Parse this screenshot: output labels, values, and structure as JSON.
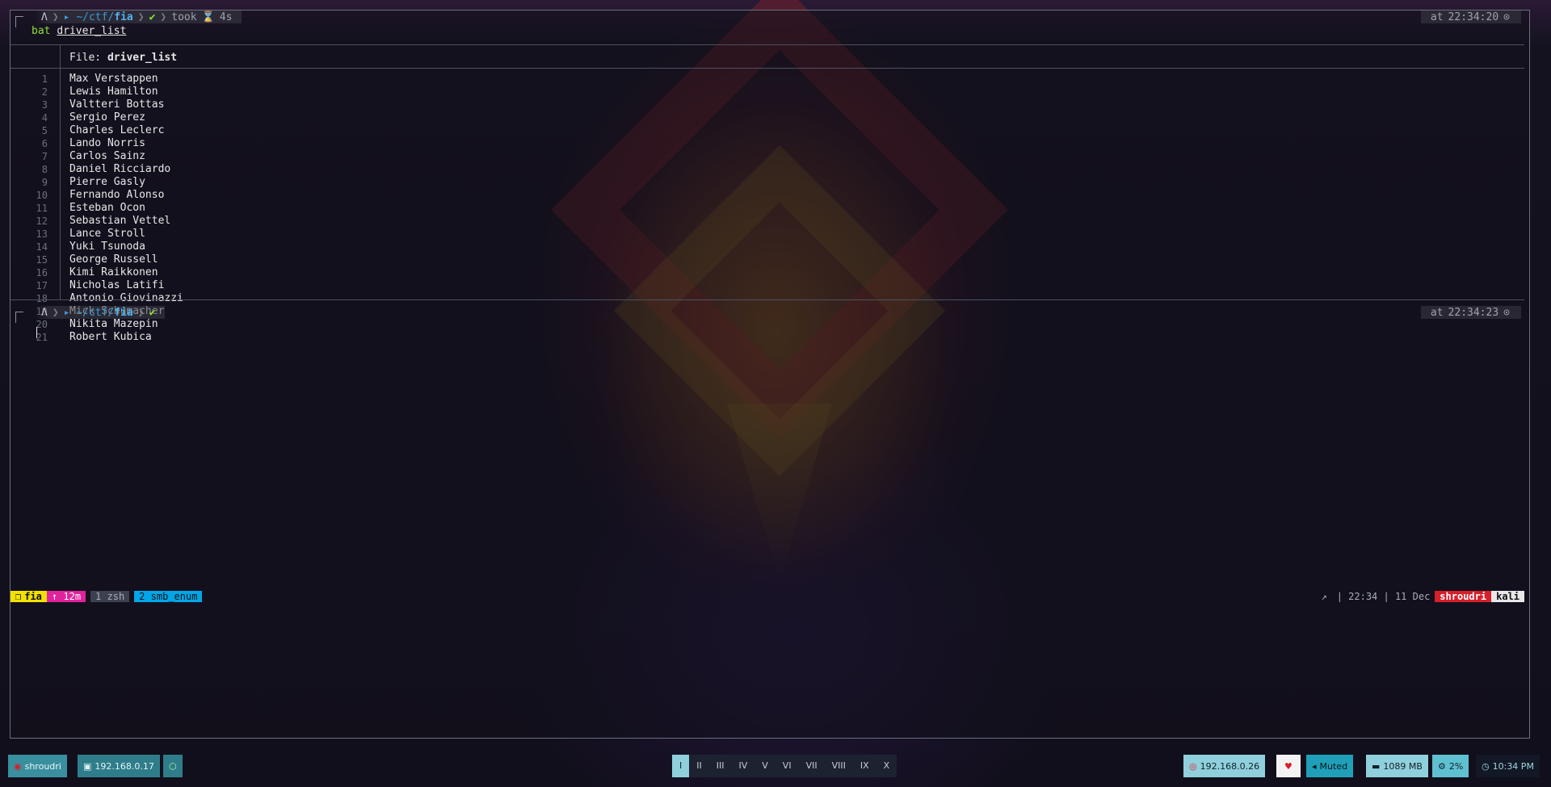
{
  "prompt1": {
    "user_icon": "Λ",
    "path_prefix": "~/ctf/",
    "path_dir": "fia",
    "status": "✔",
    "took_label": "took",
    "hourglass": "⌛",
    "duration": "4s",
    "time_label": "at",
    "time": "22:34:20",
    "clock_icon": "⊙"
  },
  "command": {
    "name": "bat",
    "arg": "driver_list"
  },
  "bat": {
    "file_label": "File:",
    "file_name": "driver_list",
    "lines": [
      {
        "n": "1",
        "text": "Max Verstappen"
      },
      {
        "n": "2",
        "text": "Lewis Hamilton"
      },
      {
        "n": "3",
        "text": "Valtteri Bottas"
      },
      {
        "n": "4",
        "text": "Sergio Perez"
      },
      {
        "n": "5",
        "text": "Charles Leclerc"
      },
      {
        "n": "6",
        "text": "Lando Norris"
      },
      {
        "n": "7",
        "text": "Carlos Sainz"
      },
      {
        "n": "8",
        "text": "Daniel Ricciardo"
      },
      {
        "n": "9",
        "text": "Pierre Gasly"
      },
      {
        "n": "10",
        "text": "Fernando Alonso"
      },
      {
        "n": "11",
        "text": "Esteban Ocon"
      },
      {
        "n": "12",
        "text": "Sebastian Vettel"
      },
      {
        "n": "13",
        "text": "Lance Stroll"
      },
      {
        "n": "14",
        "text": "Yuki Tsunoda"
      },
      {
        "n": "15",
        "text": "George Russell"
      },
      {
        "n": "16",
        "text": "Kimi Raikkonen"
      },
      {
        "n": "17",
        "text": "Nicholas Latifi"
      },
      {
        "n": "18",
        "text": "Antonio Giovinazzi"
      },
      {
        "n": "19",
        "text": "Mick Schumacher"
      },
      {
        "n": "20",
        "text": "Nikita Mazepin"
      },
      {
        "n": "21",
        "text": "Robert Kubica"
      }
    ]
  },
  "prompt2": {
    "user_icon": "Λ",
    "path_prefix": "~/ctf/",
    "path_dir": "fia",
    "status": "✔",
    "time_label": "at",
    "time": "22:34:23",
    "clock_icon": "⊙"
  },
  "tmux": {
    "session": "fia",
    "uptime": "↑ 12m",
    "windows": [
      {
        "label": "1 zsh",
        "active": false
      },
      {
        "label": "2 smb_enum",
        "active": true
      }
    ],
    "arrow": "↗",
    "clock": "| 22:34 | 11 Dec",
    "user": "shroudri",
    "host": "kali"
  },
  "polybar": {
    "user": "shroudri",
    "local_ip": "192.168.0.17",
    "workspaces": [
      "I",
      "II",
      "III",
      "IV",
      "V",
      "VI",
      "VII",
      "VIII",
      "IX",
      "X"
    ],
    "active_workspace": "I",
    "target_ip": "192.168.0.26",
    "heart": "♥",
    "volume": "Muted",
    "memory": "1089 MB",
    "cpu": "2%",
    "clock": "10:34 PM"
  }
}
